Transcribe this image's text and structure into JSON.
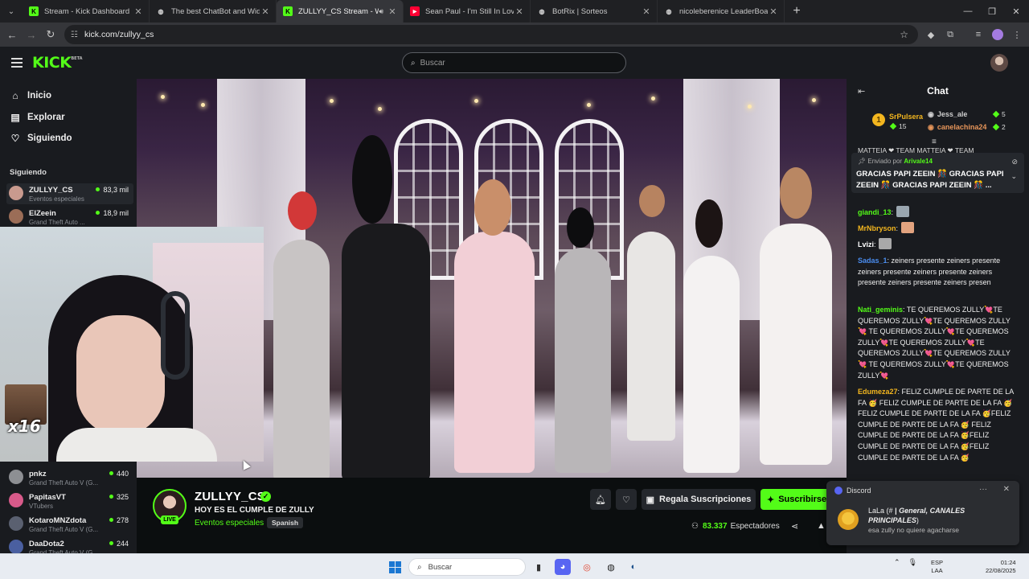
{
  "browser": {
    "tabs": [
      {
        "title": "Stream - Kick Dashboard",
        "favicon": "kick-icon",
        "color": "#53fc18"
      },
      {
        "title": "The best ChatBot and Widgets",
        "favicon": "generic-icon",
        "color": "#dddddd"
      },
      {
        "title": "ZULLYY_CS Stream - Watch",
        "favicon": "kick-icon",
        "color": "#53fc18",
        "active": true,
        "audio": true
      },
      {
        "title": "Sean Paul - I'm Still In Love With",
        "favicon": "youtube-icon",
        "color": "#ff0033"
      },
      {
        "title": "BotRix | Sorteos",
        "favicon": "generic-icon",
        "color": "#dddddd"
      },
      {
        "title": "nicoleberenice LeaderBoard | Ti",
        "favicon": "generic-icon",
        "color": "#dddddd"
      }
    ],
    "url": "kick.com/zullyy_cs"
  },
  "kick": {
    "search_placeholder": "Buscar",
    "beta": "BETA",
    "logo": "KICK"
  },
  "sidebar": {
    "nav": [
      {
        "label": "Inicio",
        "icon": "home-icon"
      },
      {
        "label": "Explorar",
        "icon": "compass-icon"
      },
      {
        "label": "Siguiendo",
        "icon": "heart-icon"
      }
    ],
    "following_header": "Siguiendo",
    "following": [
      {
        "name": "ZULLYY_CS",
        "category": "Eventos especiales",
        "viewers": "83,3 mil",
        "avatar": "#c99a8e"
      },
      {
        "name": "ElZeein",
        "category": "Grand Theft Auto ...",
        "viewers": "18,9 mil",
        "avatar": "#9b6d57"
      },
      {
        "name": "pnkz",
        "category": "Grand Theft Auto V (G...",
        "viewers": "440",
        "avatar": "#8d8f93"
      },
      {
        "name": "PapitasVT",
        "category": "VTubers",
        "viewers": "325",
        "avatar": "#d85a8a"
      },
      {
        "name": "KotaroMNZdota",
        "category": "Grand Theft Auto V (G...",
        "viewers": "278",
        "avatar": "#5a6070"
      },
      {
        "name": "DaaDota2",
        "category": "Grand Theft Auto V (G...",
        "viewers": "244",
        "avatar": "#4a5fa0"
      }
    ]
  },
  "overlay": {
    "counter": "x16"
  },
  "stream": {
    "channel": "ZULLYY_CS",
    "live": "LIVE",
    "title": "HOY ES EL CUMPLE DE ZULLY",
    "category": "Eventos especiales",
    "language": "Spanish",
    "gift_label": "Regala Suscripciones",
    "subscribe_label": "Suscribirse",
    "viewers_count": "83.337",
    "viewers_label": "Espectadores"
  },
  "chat": {
    "title": "Chat",
    "leaderboard": [
      {
        "rank": "1",
        "name": "SrPulsera",
        "count": "15",
        "color": "#f3b61f"
      },
      {
        "name": "Jess_ale",
        "count": "5",
        "color": "#cfcfcf"
      },
      {
        "name": "canelachina24",
        "count": "2",
        "color": "#e7965a"
      }
    ],
    "ticker": "MATTEIA ❤ TEAM MATTEIA ❤ TEAM",
    "pinned": {
      "by_prefix": "Enviado por",
      "by_user": "Arivale14",
      "message": "GRACIAS PAPI ZEEIN 🎊 GRACIAS PAPI ZEEIN 🎊 GRACIAS PAPI ZEEIN 🎊 ..."
    },
    "messages": [
      {
        "user": "giandi_13",
        "color": "#53fc18",
        "text": ""
      },
      {
        "user": "MrNbryson",
        "color": "#f3b61f",
        "text": ""
      },
      {
        "user": "Lvizi",
        "color": "#ffffff",
        "text": ""
      },
      {
        "user": "Sadas_1",
        "color": "#4a8df0",
        "text": "zeiners presente zeiners presente zeiners presente zeiners presente zeiners presente zeiners presente zeiners presen"
      },
      {
        "user": "Nati_geminis",
        "color": "#53fc18",
        "text": "TE QUEREMOS ZULLY💘TE QUEREMOS ZULLY💘TE QUEREMOS ZULLY💘 TE QUEREMOS ZULLY💘TE QUEREMOS ZULLY💘TE QUEREMOS ZULLY💘TE QUEREMOS ZULLY💘TE QUEREMOS ZULLY💘 TE QUEREMOS ZULLY💘TE QUEREMOS ZULLY💘"
      },
      {
        "user": "Edumeza27",
        "color": "#f3b61f",
        "text": "FELIZ CUMPLE DE PARTE DE LA FA 🥳 FELIZ CUMPLE DE PARTE DE LA FA 🥳FELIZ CUMPLE DE PARTE DE LA FA 🥳FELIZ CUMPLE DE PARTE DE LA FA 🥳 FELIZ CUMPLE DE PARTE DE LA FA 🥳FELIZ CUMPLE DE PARTE DE LA FA 🥳FELIZ CUMPLE DE PARTE DE LA FA 🥳"
      }
    ]
  },
  "discord": {
    "app": "Discord",
    "title_prefix": "LaLa (#",
    "title_channel": "| General, CANALES PRINCIPALES",
    "title_suffix": ")",
    "body": "esa zully no quiere agacharse"
  },
  "taskbar": {
    "search": "Buscar",
    "lang_top": "ESP",
    "lang_bottom": "LAA",
    "time": "01:24",
    "date": "22/08/2025"
  }
}
